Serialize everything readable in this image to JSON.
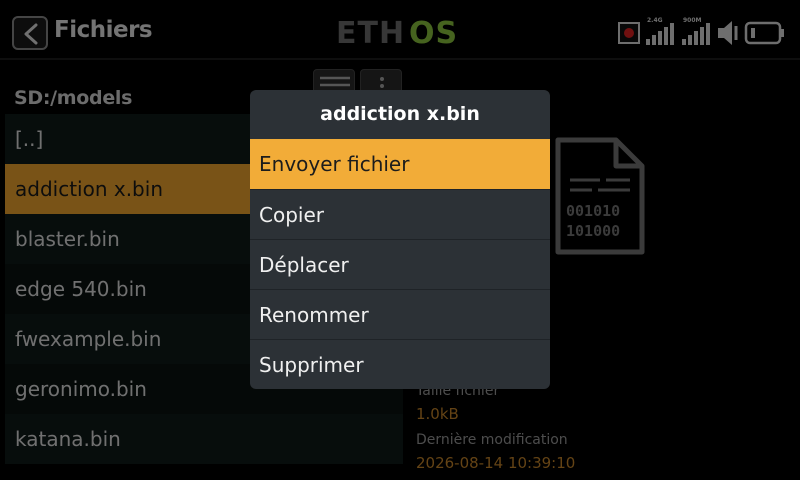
{
  "header": {
    "title": "Fichiers",
    "logo_text_left": "ETH",
    "logo_text_right": "OS",
    "logo_color_main": "#6e6e6e",
    "logo_color_accent": "#8cc63f",
    "status": {
      "freq_24": "2.4G",
      "freq_900": "900M"
    }
  },
  "browser": {
    "path": "SD:/models",
    "files": [
      {
        "name": "[..]"
      },
      {
        "name": "addiction x.bin",
        "selected": true
      },
      {
        "name": "blaster.bin"
      },
      {
        "name": "edge 540.bin"
      },
      {
        "name": "fwexample.bin"
      },
      {
        "name": "geronimo.bin"
      },
      {
        "name": "katana.bin"
      }
    ]
  },
  "details": {
    "size_label": "Taille fichier",
    "size_value": "1.0kB",
    "modified_label": "Dernière modification",
    "modified_value": "2026-08-14 10:39:10",
    "icon_line1": "001010",
    "icon_line2": "101000"
  },
  "popup": {
    "title": "addiction x.bin",
    "items": [
      {
        "label": "Envoyer fichier",
        "active": true
      },
      {
        "label": "Copier"
      },
      {
        "label": "Déplacer"
      },
      {
        "label": "Renommer"
      },
      {
        "label": "Supprimer"
      }
    ]
  },
  "colors": {
    "accent": "#f2ac38",
    "popup_bg": "#2c3136"
  }
}
